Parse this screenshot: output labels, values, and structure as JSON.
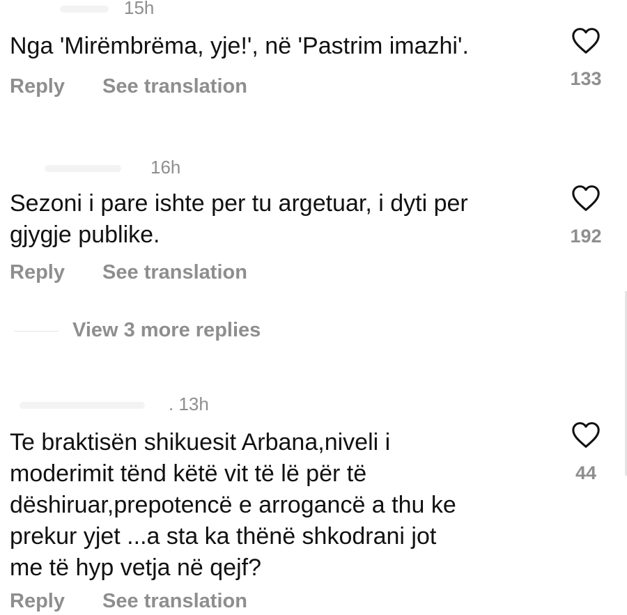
{
  "comments": [
    {
      "time": "15h",
      "text": "Nga 'Mirëmbrëma, yje!', në 'Pastrim imazhi'.",
      "likes": "133",
      "reply_label": "Reply",
      "translate_label": "See translation"
    },
    {
      "time": "16h",
      "text": "Sezoni i pare ishte per tu argetuar, i dyti per\ngjygje publike.",
      "likes": "192",
      "reply_label": "Reply",
      "translate_label": "See translation"
    },
    {
      "time": ". 13h",
      "text": "Te braktisën shikuesit Arbana,niveli i\nmoderimit tënd këtë vit të lë për të\ndëshiruar,prepotencë e arrogancë a thu ke\nprekur yjet ...a sta ka thënë shkodrani jot\nme të hyp vetja në qejf?",
      "likes": "44",
      "reply_label": "Reply",
      "translate_label": "See translation"
    }
  ],
  "view_more_replies": "View 3 more replies",
  "colors": {
    "text": "#111111",
    "secondary": "#8e8e8e",
    "background": "#ffffff"
  },
  "icons": {
    "like": "heart-outline-icon"
  }
}
